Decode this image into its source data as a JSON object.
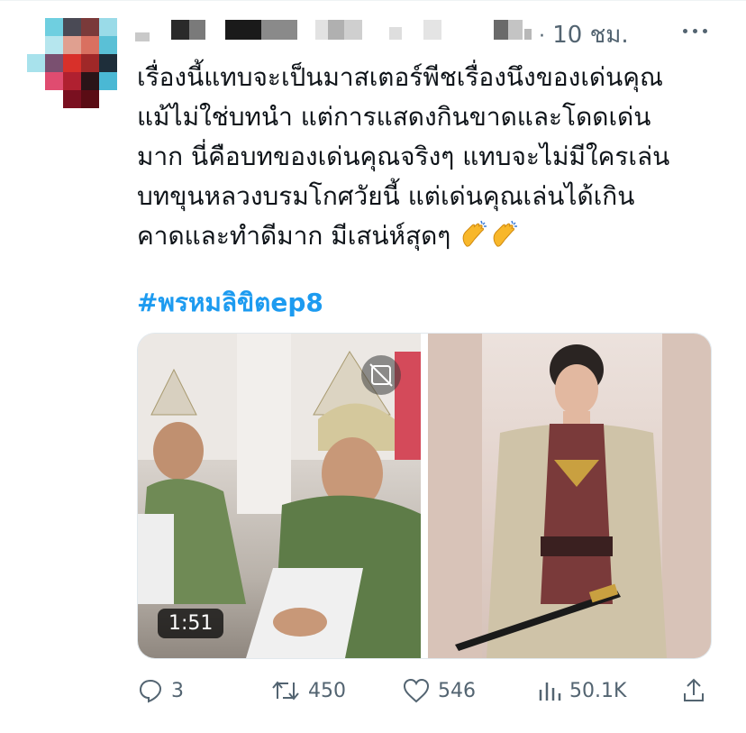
{
  "header": {
    "time": "10 ชม."
  },
  "tweet": {
    "text": "เรื่องนี้แทบจะเป็นมาสเตอร์พีชเรื่องนึงของเด่นคุณ\nแม้ไม่ใช่บทนำ แต่การแสดงกินขาดและโดดเด่น\nมาก นี่คือบทของเด่นคุณจริงๆ แทบจะไม่มีใครเล่น\nบทขุนหลวงบรมโกศวัยนี้ แต่เด่นคุณเล่นได้เกิน\nคาดและทำดีมาก มีเสน่ห์สุดๆ",
    "hashtag": "#พรหมลิขิตep8"
  },
  "media": {
    "video_duration": "1:51"
  },
  "actions": {
    "replies": "3",
    "retweets": "450",
    "likes": "546",
    "views": "50.1K"
  },
  "colors": {
    "link": "#1d9bf0",
    "muted": "#536471",
    "text": "#0f1419"
  }
}
